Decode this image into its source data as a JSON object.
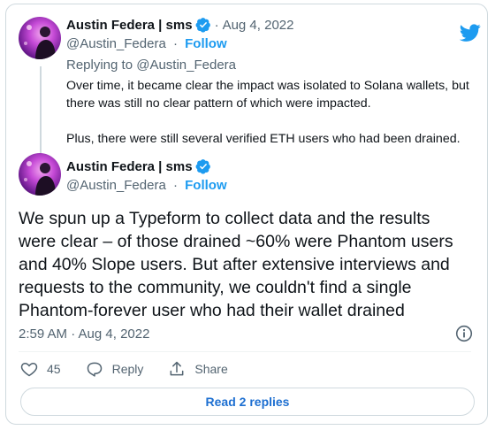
{
  "first_tweet": {
    "author_name": "Austin Federa | sms",
    "date": "Aug 4, 2022",
    "handle": "@Austin_Federa",
    "follow_label": "Follow",
    "replying_prefix": "Replying to",
    "replying_to": "@Austin_Federa",
    "paragraphs": [
      "Over time, it became clear the impact was isolated to Solana wallets, but there was still no clear pattern of which were impacted.",
      "Plus, there were still several verified ETH users who had been drained."
    ]
  },
  "main_tweet": {
    "author_name": "Austin Federa | sms",
    "handle": "@Austin_Federa",
    "follow_label": "Follow",
    "text": "We spun up a Typeform to collect data and the results were clear – of those drained ~60% were Phantom users and 40% Slope users. But after extensive interviews and requests to the community, we couldn't find a single Phantom-forever user who had their wallet drained",
    "timestamp": "2:59 AM · Aug 4, 2022"
  },
  "actions": {
    "like_count": "45",
    "reply_label": "Reply",
    "share_label": "Share"
  },
  "read_replies_label": "Read 2 replies",
  "separator": "·",
  "colors": {
    "accent": "#1d9bf0",
    "text": "#0f1419",
    "muted": "#536471",
    "border": "#cfd9de"
  },
  "icons": [
    "twitter-bird-icon",
    "verified-badge-icon",
    "info-icon",
    "heart-icon",
    "reply-bubble-icon",
    "share-icon"
  ]
}
